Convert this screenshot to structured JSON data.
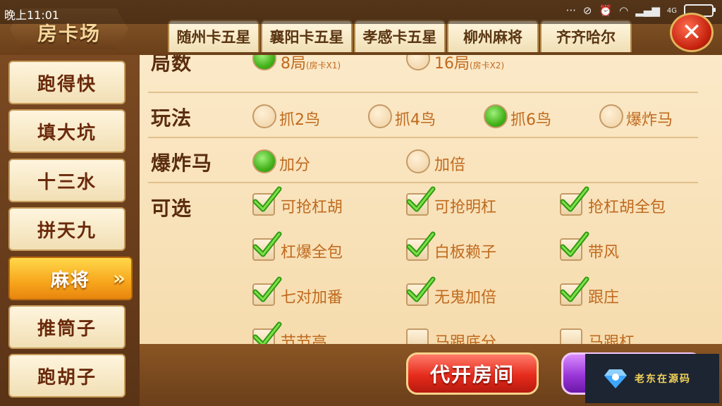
{
  "status_bar": {
    "time": "晚上11:01",
    "signal_text": "4G"
  },
  "header": {
    "title": "房卡场",
    "tabs": [
      "随州卡五星",
      "襄阳卡五星",
      "孝感卡五星",
      "柳州麻将",
      "齐齐哈尔"
    ]
  },
  "sidebar": {
    "items": [
      {
        "label": "跑得快"
      },
      {
        "label": "填大坑"
      },
      {
        "label": "十三水"
      },
      {
        "label": "拼天九"
      },
      {
        "label": "麻将"
      },
      {
        "label": "推筒子"
      },
      {
        "label": "跑胡子"
      }
    ],
    "active_item": "麻将"
  },
  "rounds": {
    "label": "局数",
    "options": [
      {
        "label": "8局",
        "note": "(房卡X1)",
        "selected": true
      },
      {
        "label": "16局",
        "note": "(房卡X2)",
        "selected": false
      }
    ]
  },
  "play": {
    "label": "玩法",
    "options": [
      {
        "label": "抓2鸟",
        "selected": false
      },
      {
        "label": "抓4鸟",
        "selected": false
      },
      {
        "label": "抓6鸟",
        "selected": true
      },
      {
        "label": "爆炸马",
        "selected": false
      }
    ]
  },
  "bomb_horse": {
    "label": "爆炸马",
    "options": [
      {
        "label": "加分",
        "selected": true
      },
      {
        "label": "加倍",
        "selected": false
      }
    ]
  },
  "optional": {
    "label": "可选",
    "options": [
      {
        "label": "可抢杠胡",
        "checked": true
      },
      {
        "label": "可抢明杠",
        "checked": true
      },
      {
        "label": "抢杠胡全包",
        "checked": true
      },
      {
        "label": "杠爆全包",
        "checked": true
      },
      {
        "label": "白板赖子",
        "checked": true
      },
      {
        "label": "带风",
        "checked": true
      },
      {
        "label": "七对加番",
        "checked": true
      },
      {
        "label": "无鬼加倍",
        "checked": true
      },
      {
        "label": "跟庄",
        "checked": true
      },
      {
        "label": "节节高",
        "checked": true
      },
      {
        "label": "马跟底分",
        "checked": false
      },
      {
        "label": "马跟杠",
        "checked": false
      }
    ]
  },
  "buttons": {
    "proxy_open": "代开房间"
  },
  "watermark": {
    "text": "老东在源码"
  },
  "colors": {
    "accent_orange": "#f7a51b",
    "radio_on": "#44b21a",
    "close_red": "#c5220e"
  }
}
